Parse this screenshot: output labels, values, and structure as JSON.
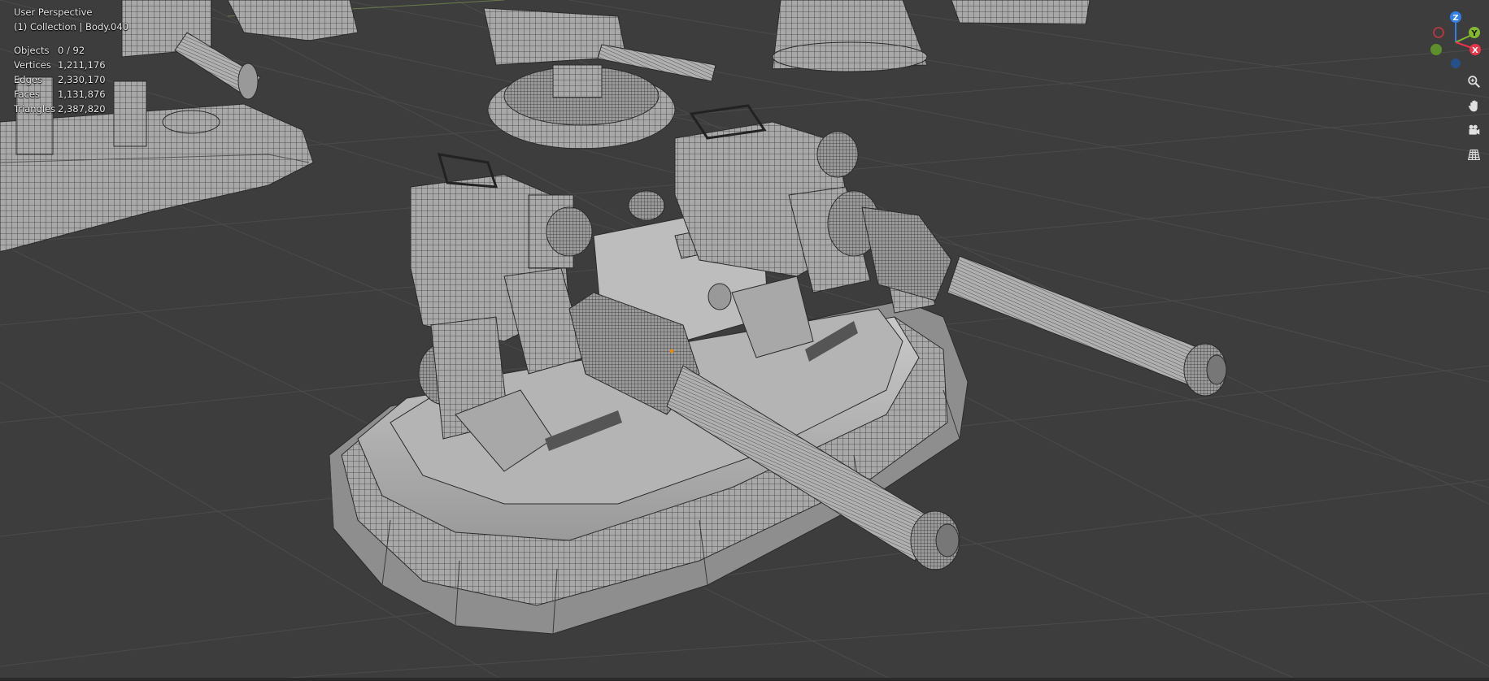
{
  "viewport": {
    "mode": "User Perspective",
    "context": "(1) Collection | Body.040",
    "background_color": "#3d3d3d",
    "grid_color": "#4a4a4a",
    "mesh_color": "#a9a9a9",
    "wire_color": "#2b2b2b"
  },
  "stats": [
    {
      "label": "Objects",
      "value": "0 / 92"
    },
    {
      "label": "Vertices",
      "value": "1,211,176"
    },
    {
      "label": "Edges",
      "value": "2,330,170"
    },
    {
      "label": "Faces",
      "value": "1,131,876"
    },
    {
      "label": "Triangles",
      "value": "2,387,820"
    }
  ],
  "gizmo": {
    "axes": [
      {
        "name": "Z",
        "color": "#2f7fe8"
      },
      {
        "name": "Y",
        "color": "#84b82f"
      },
      {
        "name": "X",
        "color": "#e8354a"
      }
    ]
  },
  "nav_tools": [
    {
      "name": "zoom-icon"
    },
    {
      "name": "hand-icon"
    },
    {
      "name": "camera-icon"
    },
    {
      "name": "grid-icon"
    }
  ]
}
